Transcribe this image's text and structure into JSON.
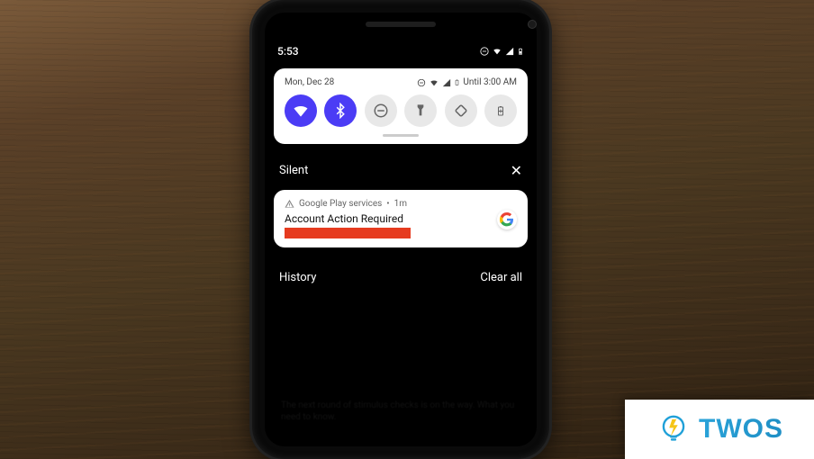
{
  "statusbar": {
    "time": "5:53"
  },
  "quick_settings": {
    "date": "Mon, Dec 28",
    "dnd_until": "Until 3:00 AM",
    "tiles": [
      {
        "name": "wifi-icon",
        "active": true
      },
      {
        "name": "bluetooth-icon",
        "active": true
      },
      {
        "name": "dnd-icon",
        "active": false
      },
      {
        "name": "flashlight-icon",
        "active": false
      },
      {
        "name": "rotate-icon",
        "active": false
      },
      {
        "name": "battery-saver-icon",
        "active": false
      }
    ]
  },
  "silent_section": {
    "label": "Silent"
  },
  "notification": {
    "app": "Google Play services",
    "age": "1m",
    "title": "Account Action Required"
  },
  "footer": {
    "history": "History",
    "clear": "Clear all"
  },
  "brand": {
    "text": "TWOS"
  }
}
